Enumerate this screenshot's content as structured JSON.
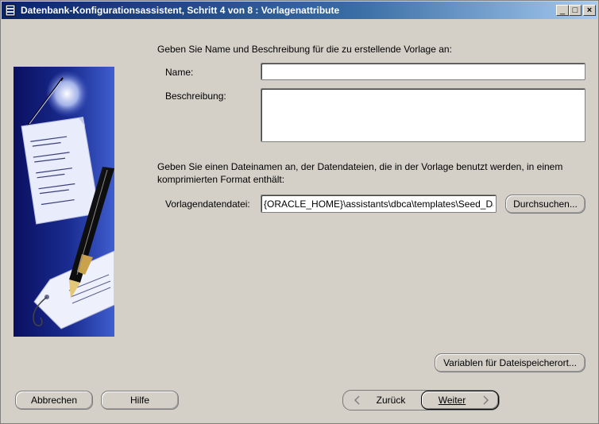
{
  "window": {
    "title": "Datenbank-Konfigurationsassistent, Schritt 4 von 8 : Vorlagenattribute",
    "controls": {
      "minimize": "_",
      "maximize": "□",
      "close": "×"
    }
  },
  "form": {
    "intro": "Geben Sie Name und Beschreibung für die zu erstellende Vorlage an:",
    "name_label": "Name:",
    "name_value": "",
    "description_label": "Beschreibung:",
    "description_value": "",
    "datafile_intro_line1": "Geben Sie einen Dateinamen an, der Datendateien, die in der Vorlage benutzt werden, in einem",
    "datafile_intro_line2": "komprimierten Format enthält:",
    "datafile_label": "Vorlagendatendatei:",
    "datafile_value": "{ORACLE_HOME}\\assistants\\dbca\\templates\\Seed_Database.dfj",
    "browse_button": "Durchsuchen...",
    "variables_button": "Variablen für Dateispeicherort..."
  },
  "footer": {
    "cancel": "Abbrechen",
    "help": "Hilfe",
    "back": "Zurück",
    "next": "Weiter"
  },
  "icons": {
    "back": "chevron-left-icon",
    "next": "chevron-right-icon",
    "app": "database-icon"
  },
  "colors": {
    "window_bg": "#d4d0c8",
    "titlebar_start": "#0a246a",
    "titlebar_end": "#a6caf0",
    "illustration_bg": "#0c1468"
  }
}
